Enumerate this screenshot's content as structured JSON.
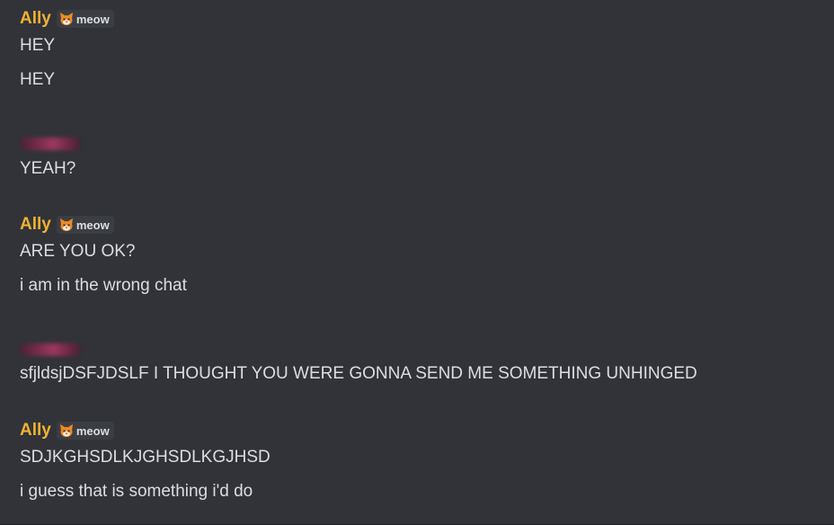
{
  "colors": {
    "background": "#313338",
    "text": "#dbdee1",
    "ally_name": "#f0b232",
    "tag_background": "#3b3d44",
    "redacted_name": "#b13a68"
  },
  "tag": {
    "icon": "cat-face-icon",
    "label": "meow"
  },
  "messages": [
    {
      "author": "Ally",
      "author_redacted": false,
      "lines": [
        "HEY",
        "HEY"
      ]
    },
    {
      "author": "",
      "author_redacted": true,
      "lines": [
        "YEAH?"
      ]
    },
    {
      "author": "Ally",
      "author_redacted": false,
      "lines": [
        "ARE YOU OK?",
        "i am in the wrong chat"
      ]
    },
    {
      "author": "",
      "author_redacted": true,
      "lines": [
        "sfjldsjDSFJDSLF I THOUGHT YOU WERE GONNA SEND ME SOMETHING UNHINGED"
      ]
    },
    {
      "author": "Ally",
      "author_redacted": false,
      "lines": [
        "SDJKGHSDLKJGHSDLKGJHSD",
        "i guess that is something i'd do"
      ]
    }
  ]
}
